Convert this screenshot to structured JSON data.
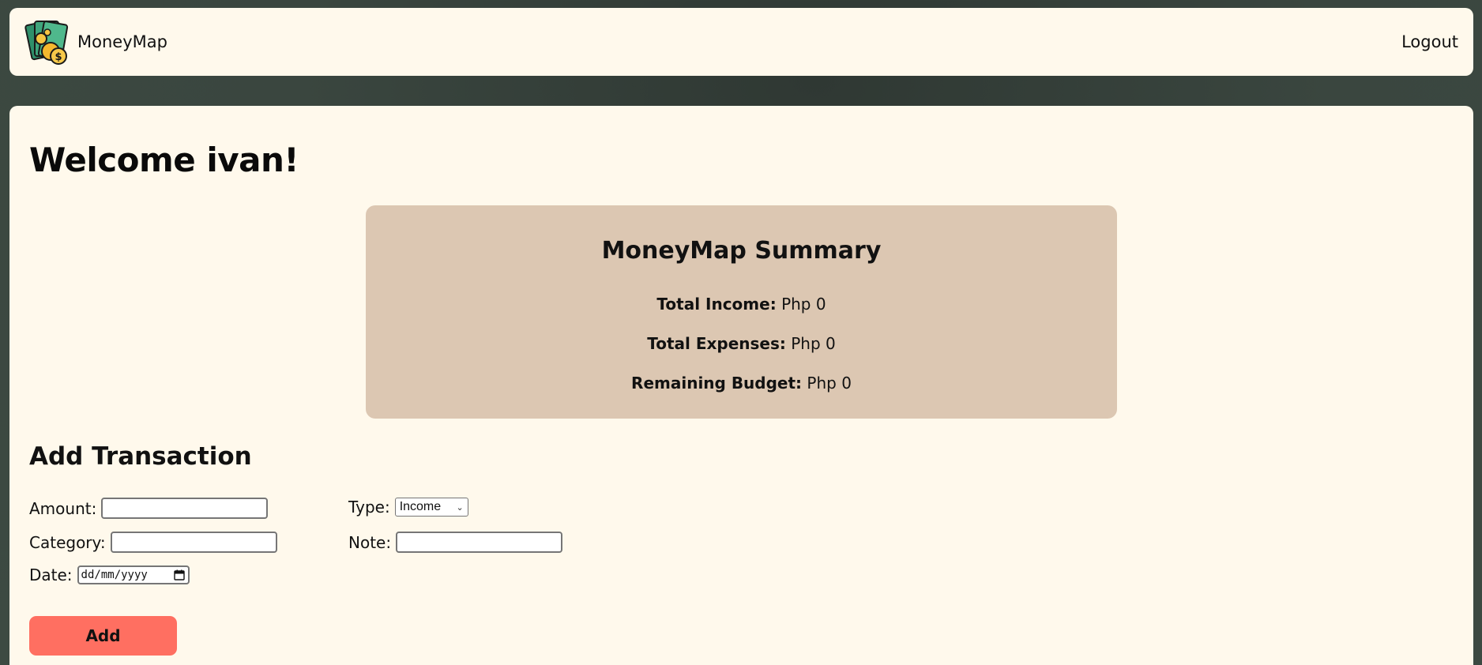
{
  "app": {
    "name": "MoneyMap",
    "logout_label": "Logout"
  },
  "welcome": "Welcome ivan!",
  "summary": {
    "title": "MoneyMap Summary",
    "income_label": "Total Income:",
    "income_value": "Php 0",
    "expenses_label": "Total Expenses:",
    "expenses_value": "Php 0",
    "remaining_label": "Remaining Budget:",
    "remaining_value": "Php 0"
  },
  "form": {
    "title": "Add Transaction",
    "amount_label": "Amount:",
    "amount_value": "",
    "category_label": "Category:",
    "category_value": "",
    "date_label": "Date:",
    "date_placeholder": "dd/mm/yyyy",
    "type_label": "Type:",
    "type_value": "Income",
    "note_label": "Note:",
    "note_value": "",
    "submit_label": "Add"
  },
  "colors": {
    "background": "#3a463f",
    "panel": "#fff9ec",
    "summary_bg": "#dcc7b2",
    "button": "#ff6f61"
  },
  "icons": [
    "money-logo-icon",
    "calendar-icon",
    "chevron-down-icon"
  ]
}
